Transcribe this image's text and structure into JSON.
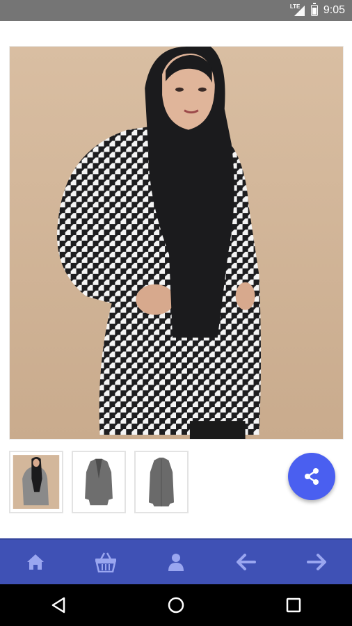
{
  "status_bar": {
    "network": "LTE",
    "time": "9:05"
  },
  "product": {
    "main_image": "houndstooth-coat-model-photo",
    "thumbnails": [
      {
        "name": "thumbnail-model"
      },
      {
        "name": "thumbnail-coat-front"
      },
      {
        "name": "thumbnail-coat-back"
      }
    ]
  },
  "share_button": {
    "icon": "share-icon"
  },
  "bottom_nav": {
    "items": [
      {
        "icon": "home-icon"
      },
      {
        "icon": "basket-icon"
      },
      {
        "icon": "user-icon"
      },
      {
        "icon": "arrow-left-icon"
      },
      {
        "icon": "arrow-right-icon"
      }
    ]
  },
  "system_nav": {
    "items": [
      "back",
      "home",
      "recents"
    ]
  },
  "colors": {
    "status_bar": "#757575",
    "nav_bar": "#3f51b5",
    "fab": "#4a5ff0",
    "nav_icon": "#9aa6f0",
    "photo_background": "#d3b79b"
  }
}
